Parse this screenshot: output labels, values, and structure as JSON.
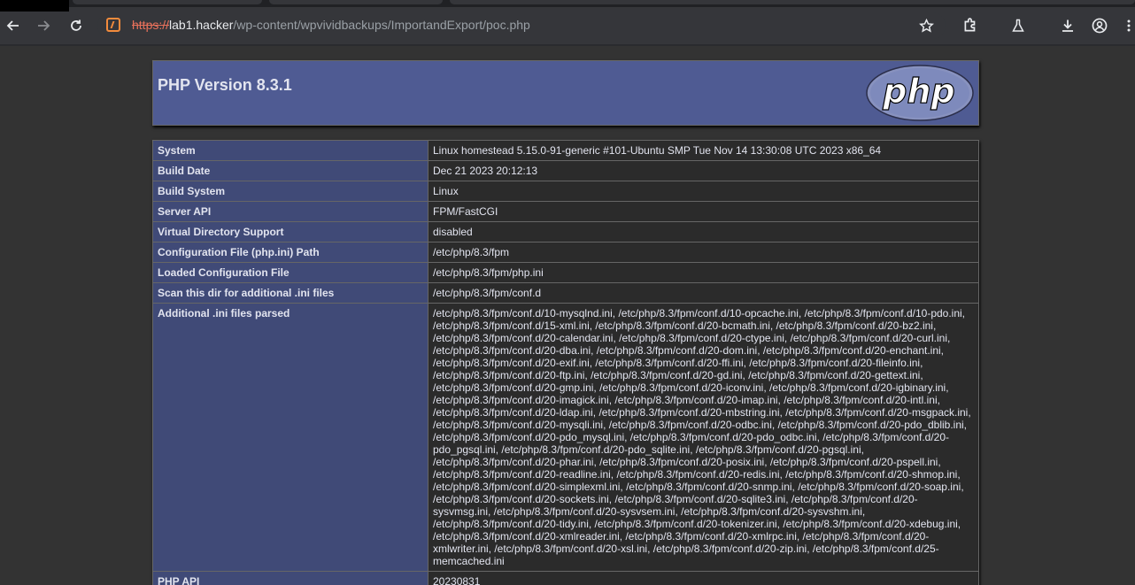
{
  "browser": {
    "url_scheme": "https://",
    "url_host": "lab1.hacker",
    "url_path": "/wp-content/wpvividbackups/ImportandExport/poc.php",
    "icons": [
      "back-icon",
      "forward-icon",
      "reload-icon",
      "site-info-icon",
      "bookmark-star-icon",
      "extensions-icon",
      "labs-icon",
      "download-icon",
      "profile-icon",
      "menu-icon"
    ]
  },
  "page": {
    "title": "PHP Version 8.3.1",
    "logo_text": "php"
  },
  "info_rows": [
    {
      "label": "System",
      "value": "Linux homestead 5.15.0-91-generic #101-Ubuntu SMP Tue Nov 14 13:30:08 UTC 2023 x86_64"
    },
    {
      "label": "Build Date",
      "value": "Dec 21 2023 20:12:13"
    },
    {
      "label": "Build System",
      "value": "Linux"
    },
    {
      "label": "Server API",
      "value": "FPM/FastCGI"
    },
    {
      "label": "Virtual Directory Support",
      "value": "disabled"
    },
    {
      "label": "Configuration File (php.ini) Path",
      "value": "/etc/php/8.3/fpm"
    },
    {
      "label": "Loaded Configuration File",
      "value": "/etc/php/8.3/fpm/php.ini"
    },
    {
      "label": "Scan this dir for additional .ini files",
      "value": "/etc/php/8.3/fpm/conf.d"
    },
    {
      "label": "Additional .ini files parsed",
      "value": "/etc/php/8.3/fpm/conf.d/10-mysqlnd.ini, /etc/php/8.3/fpm/conf.d/10-opcache.ini, /etc/php/8.3/fpm/conf.d/10-pdo.ini, /etc/php/8.3/fpm/conf.d/15-xml.ini, /etc/php/8.3/fpm/conf.d/20-bcmath.ini, /etc/php/8.3/fpm/conf.d/20-bz2.ini, /etc/php/8.3/fpm/conf.d/20-calendar.ini, /etc/php/8.3/fpm/conf.d/20-ctype.ini, /etc/php/8.3/fpm/conf.d/20-curl.ini, /etc/php/8.3/fpm/conf.d/20-dba.ini, /etc/php/8.3/fpm/conf.d/20-dom.ini, /etc/php/8.3/fpm/conf.d/20-enchant.ini, /etc/php/8.3/fpm/conf.d/20-exif.ini, /etc/php/8.3/fpm/conf.d/20-ffi.ini, /etc/php/8.3/fpm/conf.d/20-fileinfo.ini, /etc/php/8.3/fpm/conf.d/20-ftp.ini, /etc/php/8.3/fpm/conf.d/20-gd.ini, /etc/php/8.3/fpm/conf.d/20-gettext.ini, /etc/php/8.3/fpm/conf.d/20-gmp.ini, /etc/php/8.3/fpm/conf.d/20-iconv.ini, /etc/php/8.3/fpm/conf.d/20-igbinary.ini, /etc/php/8.3/fpm/conf.d/20-imagick.ini, /etc/php/8.3/fpm/conf.d/20-imap.ini, /etc/php/8.3/fpm/conf.d/20-intl.ini, /etc/php/8.3/fpm/conf.d/20-ldap.ini, /etc/php/8.3/fpm/conf.d/20-mbstring.ini, /etc/php/8.3/fpm/conf.d/20-msgpack.ini, /etc/php/8.3/fpm/conf.d/20-mysqli.ini, /etc/php/8.3/fpm/conf.d/20-odbc.ini, /etc/php/8.3/fpm/conf.d/20-pdo_dblib.ini, /etc/php/8.3/fpm/conf.d/20-pdo_mysql.ini, /etc/php/8.3/fpm/conf.d/20-pdo_odbc.ini, /etc/php/8.3/fpm/conf.d/20-pdo_pgsql.ini, /etc/php/8.3/fpm/conf.d/20-pdo_sqlite.ini, /etc/php/8.3/fpm/conf.d/20-pgsql.ini, /etc/php/8.3/fpm/conf.d/20-phar.ini, /etc/php/8.3/fpm/conf.d/20-posix.ini, /etc/php/8.3/fpm/conf.d/20-pspell.ini, /etc/php/8.3/fpm/conf.d/20-readline.ini, /etc/php/8.3/fpm/conf.d/20-redis.ini, /etc/php/8.3/fpm/conf.d/20-shmop.ini, /etc/php/8.3/fpm/conf.d/20-simplexml.ini, /etc/php/8.3/fpm/conf.d/20-snmp.ini, /etc/php/8.3/fpm/conf.d/20-soap.ini, /etc/php/8.3/fpm/conf.d/20-sockets.ini, /etc/php/8.3/fpm/conf.d/20-sqlite3.ini, /etc/php/8.3/fpm/conf.d/20-sysvmsg.ini, /etc/php/8.3/fpm/conf.d/20-sysvsem.ini, /etc/php/8.3/fpm/conf.d/20-sysvshm.ini, /etc/php/8.3/fpm/conf.d/20-tidy.ini, /etc/php/8.3/fpm/conf.d/20-tokenizer.ini, /etc/php/8.3/fpm/conf.d/20-xdebug.ini, /etc/php/8.3/fpm/conf.d/20-xmlreader.ini, /etc/php/8.3/fpm/conf.d/20-xmlrpc.ini, /etc/php/8.3/fpm/conf.d/20-xmlwriter.ini, /etc/php/8.3/fpm/conf.d/20-xsl.ini, /etc/php/8.3/fpm/conf.d/20-zip.ini, /etc/php/8.3/fpm/conf.d/25-memcached.ini"
    },
    {
      "label": "PHP API",
      "value": "20230831"
    }
  ],
  "colors": {
    "header_bg": "#4f5b93",
    "label_bg": "#404a77",
    "value_bg": "#2b2b2b",
    "page_bg": "#333333"
  }
}
